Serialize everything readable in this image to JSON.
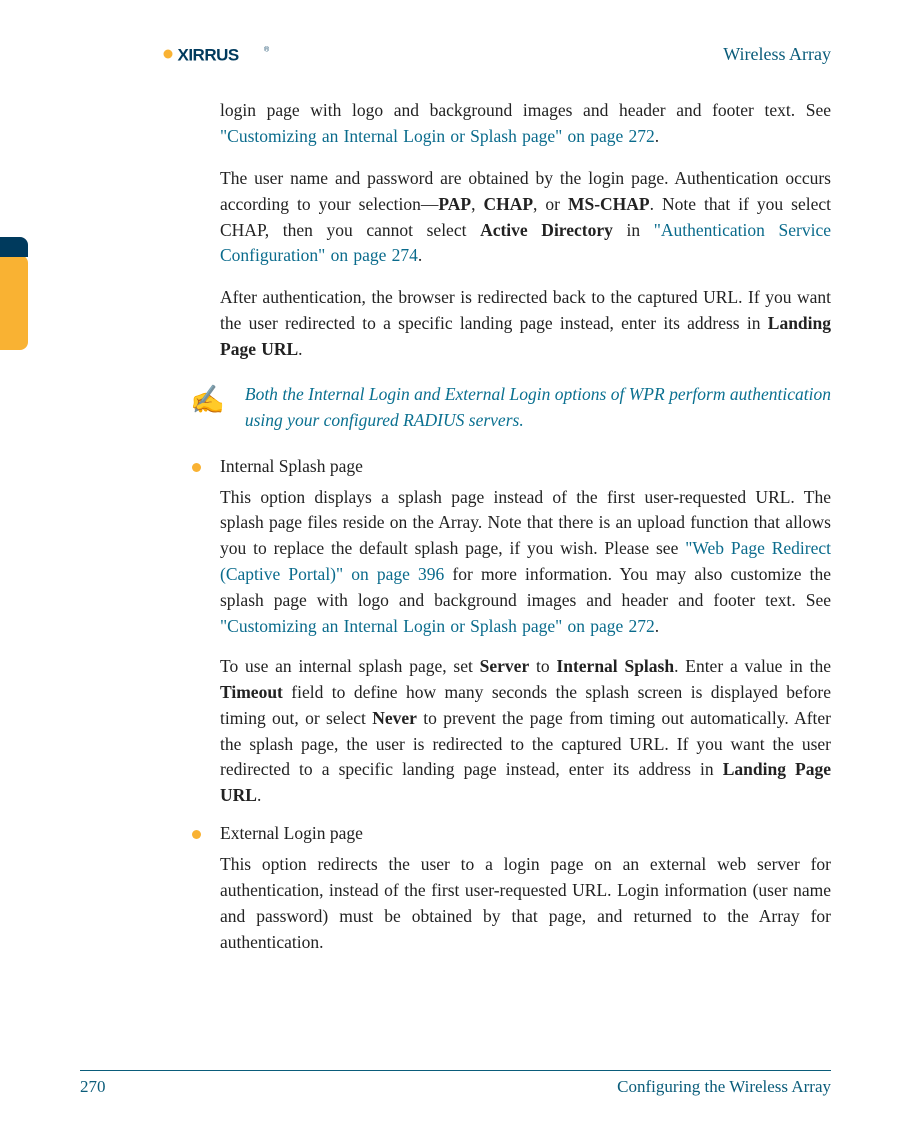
{
  "header": {
    "logo": "XIRRUS",
    "title": "Wireless Array"
  },
  "body": {
    "para1_pre": "login page with logo and background images and header and footer text. See ",
    "para1_link": "\"Customizing an Internal Login or Splash page\" on page 272",
    "para1_post": ".",
    "para2_a": "The user name and password are obtained by the login page. Authentication occurs according to your selection—",
    "para2_b": "PAP",
    "para2_c": ", ",
    "para2_d": "CHAP",
    "para2_e": ", or ",
    "para2_f": "MS-CHAP",
    "para2_g": ". Note that if you select CHAP, then you cannot select ",
    "para2_h": "Active Directory",
    "para2_i": " in ",
    "para2_link": "\"Authentication Service Configuration\" on page 274",
    "para2_j": ".",
    "para3_a": "After authentication, the browser is redirected back to the captured URL. If you want the user redirected to a specific landing page instead, enter its address in ",
    "para3_b": "Landing Page URL",
    "para3_c": ".",
    "note": "Both the Internal Login and External Login options of WPR perform authentication using your configured RADIUS servers.",
    "bullet1": {
      "title": "Internal Splash page",
      "p1_a": "This option displays a splash page instead of the first user-requested URL. The splash page files reside on the Array. Note that there is an upload function that allows you to replace the default splash page, if you wish. Please see ",
      "p1_link1": "\"Web Page Redirect (Captive Portal)\" on page 396",
      "p1_b": " for more information. You may also customize the splash page with logo and background images and header and footer text. See ",
      "p1_link2": "\"Customizing an Internal Login or Splash page\" on page 272",
      "p1_c": ".",
      "p2_a": "To use an internal splash page, set ",
      "p2_b": "Server",
      "p2_c": " to ",
      "p2_d": "Internal Splash",
      "p2_e": ". Enter a value in the ",
      "p2_f": "Timeout",
      "p2_g": " field to define how many seconds the splash screen is displayed before timing out, or select ",
      "p2_h": "Never",
      "p2_i": " to prevent the page from timing out automatically. After the splash page, the user is redirected to the captured URL. If you want the user redirected to a specific landing page instead, enter its address in ",
      "p2_j": "Landing Page URL",
      "p2_k": "."
    },
    "bullet2": {
      "title": "External Login page",
      "p1": "This option redirects the user to a login page on an external web server for authentication, instead of the first user-requested URL. Login information (user name and password) must be obtained by that page, and returned to the Array for authentication."
    }
  },
  "footer": {
    "page": "270",
    "section": "Configuring the Wireless Array"
  }
}
